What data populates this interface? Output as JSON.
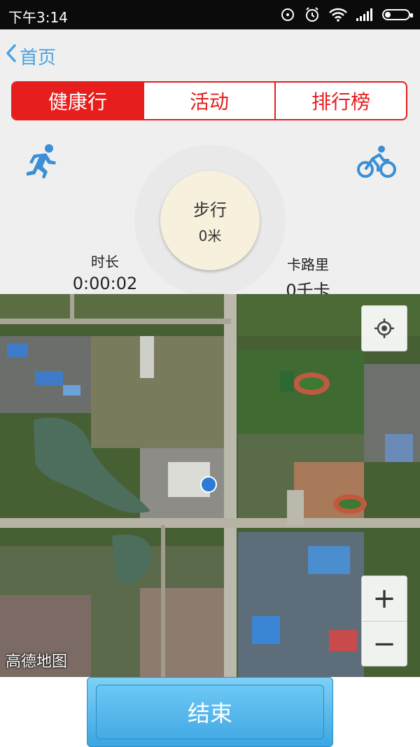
{
  "status_bar": {
    "time": "下午3:14"
  },
  "header": {
    "back_label": "首页"
  },
  "tabs": [
    {
      "label": "健康行",
      "active": true
    },
    {
      "label": "活动",
      "active": false
    },
    {
      "label": "排行榜",
      "active": false
    }
  ],
  "mode_icons": {
    "left": "running-icon",
    "right": "bicycle-icon"
  },
  "center": {
    "title": "步行",
    "distance": "0米"
  },
  "stats": {
    "duration_label": "时长",
    "duration_value": "0:00:02",
    "calories_label": "卡路里",
    "calories_value": "0千卡"
  },
  "map": {
    "logo": "高德地图",
    "zoom_in": "+",
    "zoom_out": "−"
  },
  "end_button": {
    "label": "结束"
  },
  "colors": {
    "accent_red": "#e61e1e",
    "link_blue": "#4aa3df",
    "button_blue": "#45abe5"
  }
}
